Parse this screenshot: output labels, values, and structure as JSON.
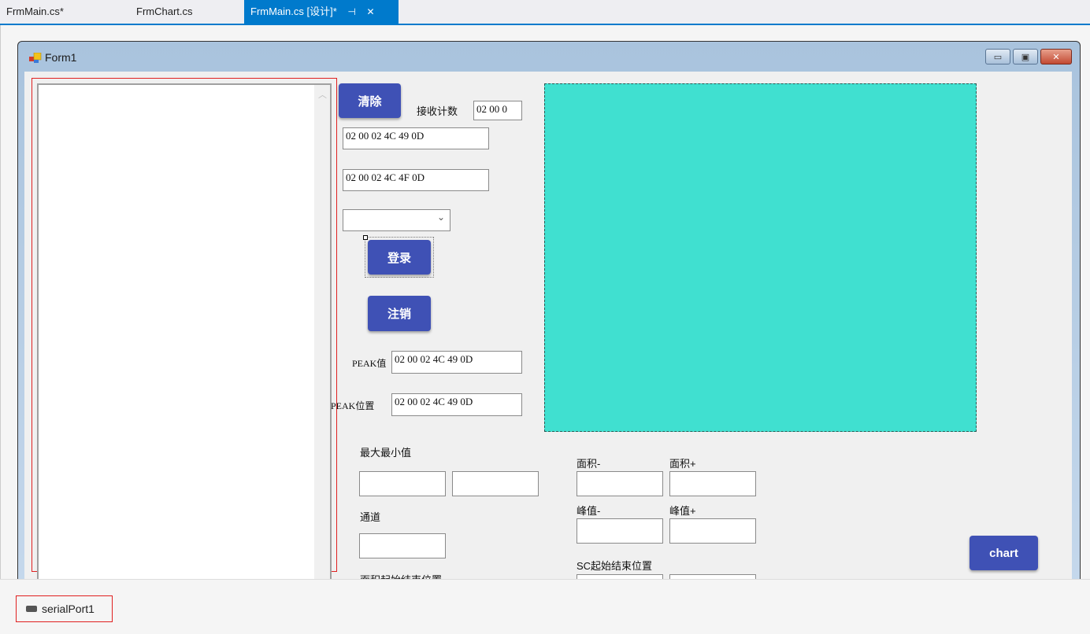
{
  "tabs": [
    {
      "label": "FrmMain.cs*",
      "active": false
    },
    {
      "label": "FrmChart.cs",
      "active": false
    },
    {
      "label": "FrmMain.cs [设计]*",
      "active": true
    }
  ],
  "tab_icons": {
    "pin": "⊣",
    "close": "✕"
  },
  "form": {
    "title": "Form1",
    "buttons": {
      "minimize": "▭",
      "maximize": "▣",
      "close": "✕"
    },
    "clear_button": "清除",
    "receive_count_label": "接收计数",
    "receive_count_value": "02 00 0",
    "cmd1_value": "02 00 02 4C 49 0D",
    "cmd2_value": "02 00 02 4C 4F 0D",
    "combo_value": "",
    "login_button": "登录",
    "logout_button": "注销",
    "peak_value_label": "PEAK值",
    "peak_value": "02 00 02 4C 49 0D",
    "peak_pos_label": "PEAK位置",
    "peak_pos": "02 00 02 4C 49 0D",
    "maxmin_label": "最大最小值",
    "max_value": "",
    "min_value": "",
    "channel_label": "通道",
    "channel_value": "",
    "area_range_label": "面积起始结束位置",
    "area_minus_label": "面积-",
    "area_plus_label": "面积+",
    "area_minus_value": "",
    "area_plus_value": "",
    "peak_minus_label": "峰值-",
    "peak_plus_label": "峰值+",
    "peak_minus_value": "",
    "peak_plus_value": "",
    "sc_range_label": "SC起始结束位置",
    "chart_button": "chart",
    "panel_color": "#40e0d0",
    "button_color": "#3f51b5"
  },
  "tray": {
    "component": "serialPort1"
  }
}
